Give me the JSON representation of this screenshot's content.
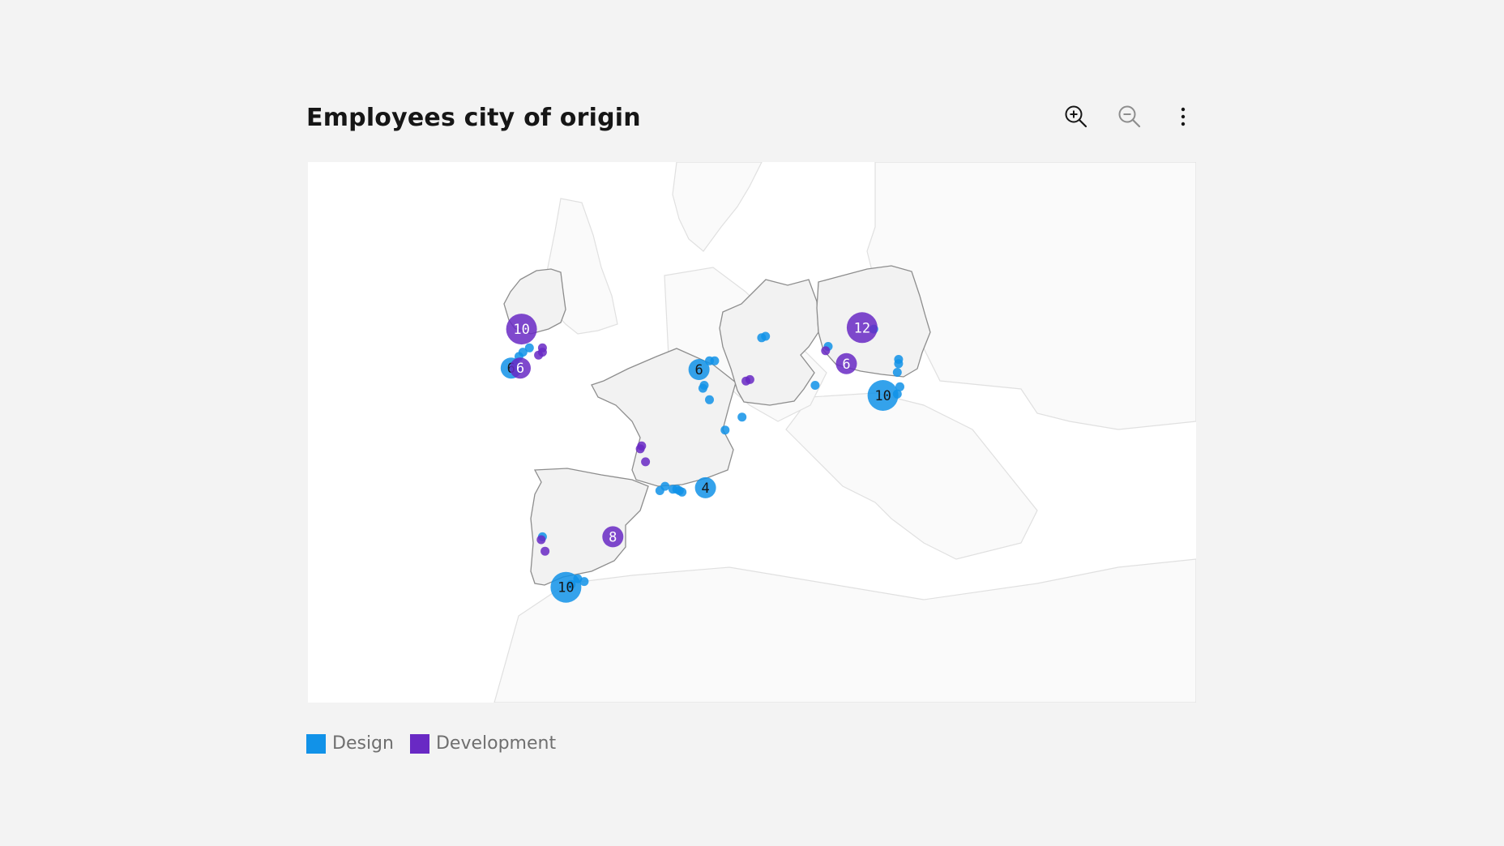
{
  "title": "Employees city of origin",
  "toolbar": {
    "zoom_in_icon": "zoom-in-icon",
    "zoom_out_icon": "zoom-out-icon",
    "overflow_icon": "overflow-menu-vertical-icon"
  },
  "colors": {
    "design": "#1192e8",
    "development": "#6929c4",
    "land_highlight": "#f2f2f2",
    "land": "#fafafa",
    "border_highlight": "#8d8d8d",
    "border": "#e0e0e0"
  },
  "legend": [
    {
      "label": "Design",
      "series": "design"
    },
    {
      "label": "Development",
      "series": "development"
    }
  ],
  "highlighted_regions": [
    "Ireland",
    "France",
    "Spain",
    "Germany",
    "Poland"
  ],
  "clusters": [
    {
      "series": "development",
      "count": "10",
      "region": "Ireland",
      "lon": -7.6,
      "lat": 54.6
    },
    {
      "series": "design",
      "count": "6",
      "region": "Ireland",
      "lon": -8.4,
      "lat": 51.9
    },
    {
      "series": "development",
      "count": "6",
      "region": "Ireland",
      "lon": -7.7,
      "lat": 51.9
    },
    {
      "series": "design",
      "count": "6",
      "region": "Netherlands/Germany",
      "lon": 6.0,
      "lat": 51.8
    },
    {
      "series": "development",
      "count": "12",
      "region": "Poland",
      "lon": 18.5,
      "lat": 54.7
    },
    {
      "series": "development",
      "count": "6",
      "region": "Poland",
      "lon": 17.3,
      "lat": 52.2
    },
    {
      "series": "design",
      "count": "10",
      "region": "Poland",
      "lon": 20.1,
      "lat": 50.0
    },
    {
      "series": "design",
      "count": "4",
      "region": "France",
      "lon": 6.5,
      "lat": 43.6
    },
    {
      "series": "development",
      "count": "8",
      "region": "Spain",
      "lon": -0.6,
      "lat": 40.2
    },
    {
      "series": "design",
      "count": "10",
      "region": "Spain",
      "lon": -4.2,
      "lat": 36.7
    }
  ],
  "points": [
    {
      "series": "design",
      "lon": -7.0,
      "lat": 53.3
    },
    {
      "series": "design",
      "lon": -7.5,
      "lat": 53.0
    },
    {
      "series": "design",
      "lon": -7.8,
      "lat": 52.7
    },
    {
      "series": "development",
      "lon": -6.3,
      "lat": 52.8
    },
    {
      "series": "development",
      "lon": -6.0,
      "lat": 53.0
    },
    {
      "series": "development",
      "lon": -6.0,
      "lat": 53.3
    },
    {
      "series": "design",
      "lon": 6.8,
      "lat": 52.4
    },
    {
      "series": "design",
      "lon": 7.2,
      "lat": 52.4
    },
    {
      "series": "design",
      "lon": 10.8,
      "lat": 54.0
    },
    {
      "series": "design",
      "lon": 11.1,
      "lat": 54.1
    },
    {
      "series": "design",
      "lon": 6.4,
      "lat": 50.7
    },
    {
      "series": "design",
      "lon": 6.3,
      "lat": 50.5
    },
    {
      "series": "design",
      "lon": 6.8,
      "lat": 49.7
    },
    {
      "series": "design",
      "lon": 8.0,
      "lat": 47.6
    },
    {
      "series": "design",
      "lon": 9.3,
      "lat": 48.5
    },
    {
      "series": "development",
      "lon": 9.6,
      "lat": 51.0
    },
    {
      "series": "development",
      "lon": 9.9,
      "lat": 51.1
    },
    {
      "series": "design",
      "lon": 19.4,
      "lat": 54.6
    },
    {
      "series": "design",
      "lon": 15.9,
      "lat": 53.4
    },
    {
      "series": "development",
      "lon": 15.7,
      "lat": 53.1
    },
    {
      "series": "design",
      "lon": 21.3,
      "lat": 52.5
    },
    {
      "series": "design",
      "lon": 21.3,
      "lat": 52.2
    },
    {
      "series": "design",
      "lon": 21.2,
      "lat": 51.6
    },
    {
      "series": "design",
      "lon": 21.4,
      "lat": 50.6
    },
    {
      "series": "design",
      "lon": 21.2,
      "lat": 50.1
    },
    {
      "series": "design",
      "lon": 14.9,
      "lat": 50.7
    },
    {
      "series": "development",
      "lon": 1.6,
      "lat": 46.5
    },
    {
      "series": "development",
      "lon": 1.5,
      "lat": 46.3
    },
    {
      "series": "development",
      "lon": 1.9,
      "lat": 45.4
    },
    {
      "series": "design",
      "lon": 3.0,
      "lat": 43.4
    },
    {
      "series": "design",
      "lon": 3.4,
      "lat": 43.7
    },
    {
      "series": "design",
      "lon": 4.0,
      "lat": 43.5
    },
    {
      "series": "design",
      "lon": 4.3,
      "lat": 43.5
    },
    {
      "series": "design",
      "lon": 4.5,
      "lat": 43.4
    },
    {
      "series": "design",
      "lon": 4.7,
      "lat": 43.3
    },
    {
      "series": "design",
      "lon": -6.0,
      "lat": 40.2
    },
    {
      "series": "development",
      "lon": -6.1,
      "lat": 40.0
    },
    {
      "series": "development",
      "lon": -5.8,
      "lat": 39.2
    },
    {
      "series": "design",
      "lon": -3.3,
      "lat": 37.3
    },
    {
      "series": "design",
      "lon": -2.8,
      "lat": 37.1
    },
    {
      "series": "design",
      "lon": -3.8,
      "lat": 36.9
    }
  ]
}
